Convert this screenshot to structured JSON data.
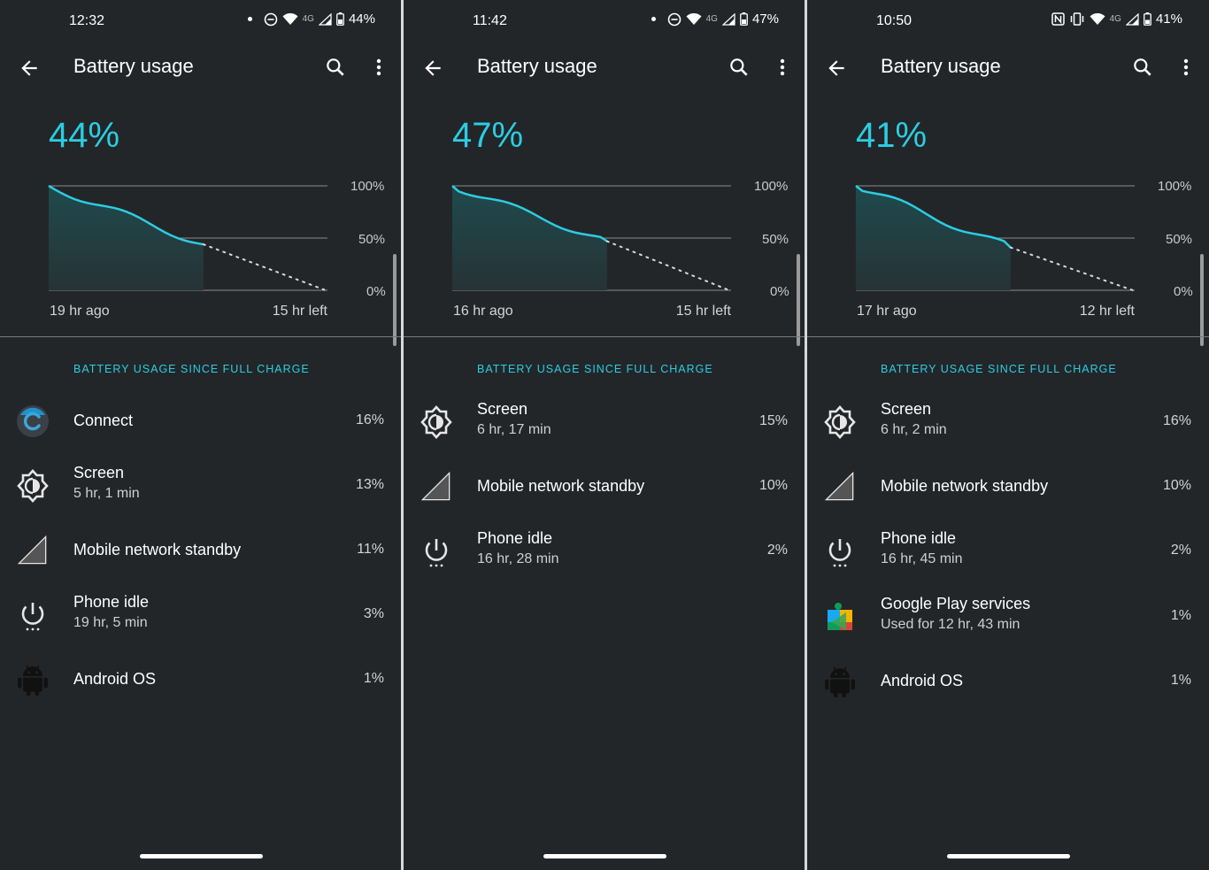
{
  "screens": [
    {
      "status": {
        "time": "12:32",
        "battery": "44%",
        "network": "4G"
      },
      "appbar": {
        "title": "Battery usage"
      },
      "chart": {
        "percent": "44%",
        "level": 0.44,
        "label_100": "100%",
        "label_50": "50%",
        "label_0": "0%",
        "time_ago": "19 hr ago",
        "time_left": "15 hr left"
      },
      "section_header": "BATTERY USAGE SINCE FULL CHARGE",
      "items": [
        {
          "name": "Connect",
          "sub": "",
          "pct": "16%",
          "icon": "connect-app-icon"
        },
        {
          "name": "Screen",
          "sub": "5 hr, 1 min",
          "pct": "13%",
          "icon": "brightness-icon"
        },
        {
          "name": "Mobile network standby",
          "sub": "",
          "pct": "11%",
          "icon": "signal-icon"
        },
        {
          "name": "Phone idle",
          "sub": "19 hr, 5 min",
          "pct": "3%",
          "icon": "power-icon"
        },
        {
          "name": "Android OS",
          "sub": "",
          "pct": "1%",
          "icon": "android-icon"
        }
      ]
    },
    {
      "status": {
        "time": "11:42",
        "battery": "47%",
        "network": "4G"
      },
      "appbar": {
        "title": "Battery usage"
      },
      "chart": {
        "percent": "47%",
        "level": 0.47,
        "label_100": "100%",
        "label_50": "50%",
        "label_0": "0%",
        "time_ago": "16 hr ago",
        "time_left": "15 hr left"
      },
      "section_header": "BATTERY USAGE SINCE FULL CHARGE",
      "items": [
        {
          "name": "Screen",
          "sub": "6 hr, 17 min",
          "pct": "15%",
          "icon": "brightness-icon"
        },
        {
          "name": "Mobile network standby",
          "sub": "",
          "pct": "10%",
          "icon": "signal-icon"
        },
        {
          "name": "Phone idle",
          "sub": "16 hr, 28 min",
          "pct": "2%",
          "icon": "power-icon"
        }
      ]
    },
    {
      "status": {
        "time": "10:50",
        "battery": "41%",
        "network": "4G"
      },
      "appbar": {
        "title": "Battery usage"
      },
      "chart": {
        "percent": "41%",
        "level": 0.41,
        "label_100": "100%",
        "label_50": "50%",
        "label_0": "0%",
        "time_ago": "17 hr ago",
        "time_left": "12 hr left"
      },
      "section_header": "BATTERY USAGE SINCE FULL CHARGE",
      "items": [
        {
          "name": "Screen",
          "sub": "6 hr, 2 min",
          "pct": "16%",
          "icon": "brightness-icon"
        },
        {
          "name": "Mobile network standby",
          "sub": "",
          "pct": "10%",
          "icon": "signal-icon"
        },
        {
          "name": "Phone idle",
          "sub": "16 hr, 45 min",
          "pct": "2%",
          "icon": "power-icon"
        },
        {
          "name": "Google Play services",
          "sub": "Used for 12 hr, 43 min",
          "pct": "1%",
          "icon": "play-services-icon"
        },
        {
          "name": "Android OS",
          "sub": "",
          "pct": "1%",
          "icon": "android-icon"
        }
      ]
    }
  ],
  "colors": {
    "accent": "#2ccde2",
    "background": "#232629",
    "chart_fill": "#1f4a4d"
  }
}
